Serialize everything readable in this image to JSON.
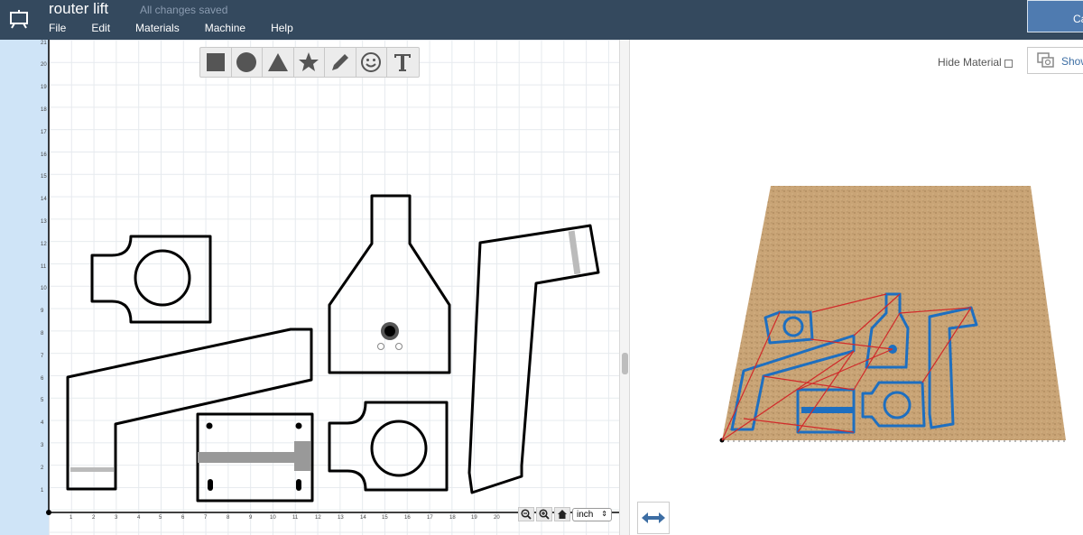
{
  "app": {
    "title": "router lift",
    "save_status": "All changes saved",
    "icon": "easel-icon",
    "accent": "#34495e"
  },
  "menu": [
    "File",
    "Edit",
    "Materials",
    "Machine",
    "Help"
  ],
  "top_button": {
    "label": "Ca"
  },
  "toolbar": {
    "tools": [
      "square-tool-icon",
      "circle-tool-icon",
      "triangle-tool-icon",
      "star-tool-icon",
      "pencil-tool-icon",
      "smiley-tool-icon",
      "text-tool-icon"
    ]
  },
  "canvas": {
    "y_ruler": [
      "21",
      "20",
      "19",
      "18",
      "17",
      "16",
      "15",
      "14",
      "13",
      "12",
      "11",
      "10",
      "9",
      "8",
      "7",
      "6",
      "5",
      "4",
      "3",
      "2",
      "1"
    ],
    "x_ruler": [
      "1",
      "2",
      "3",
      "4",
      "5",
      "6",
      "7",
      "8",
      "9",
      "10",
      "11",
      "12",
      "13",
      "14",
      "15",
      "16",
      "17",
      "18",
      "19",
      "20"
    ]
  },
  "zoom": {
    "unit": "inch",
    "icons": [
      "zoom-out-icon",
      "zoom-in-icon",
      "home-icon"
    ]
  },
  "preview_panel": {
    "hide_material_label": "Hide Material",
    "show_button_label": "Show"
  },
  "colors": {
    "toolpath": "#1e6fc0",
    "travel": "#d12a2a",
    "wood": "#c9a476"
  }
}
